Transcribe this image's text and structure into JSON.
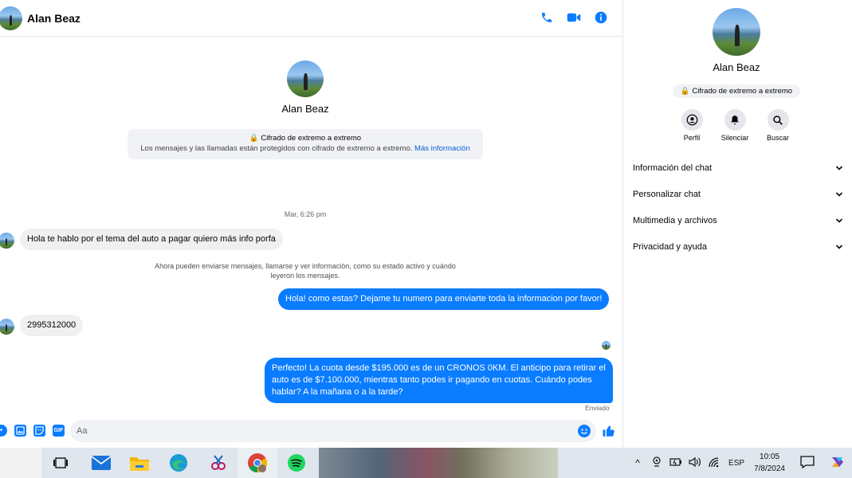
{
  "header": {
    "contact_name": "Alan Beaz",
    "icons": [
      "phone-icon",
      "video-camera-icon",
      "info-icon"
    ]
  },
  "intro": {
    "name": "Alan Beaz",
    "e2e_title": "🔒 Cifrado de extremo a extremo",
    "e2e_desc": "Los mensajes y las llamadas están protegidos con cifrado de extremo a extremo.",
    "e2e_link": "Más información"
  },
  "thread": {
    "timestamp": "Mar, 6:26 pm",
    "msg1": "Hola te hablo por el tema del auto a pagar quiero más info porfa",
    "system_note": "Ahora pueden enviarse mensajes, llamarse y ver información, como su estado activo y cuándo leyeron los mensajes.",
    "msg2": "Hola! como estas? Dejame tu numero para enviarte toda la informacion por favor!",
    "msg3": "2995312000",
    "msg4_line1": "Perfecto! La cuota desde $195.000 es de un CRONOS 0KM. El anticipo para retirar el",
    "msg4_line2": "auto es de $7.100.000, mientras tanto podes ir pagando en cuotas. Cuándo podes",
    "msg4_line3": "hablar? A la mañana o a la tarde?",
    "status": "Enviado"
  },
  "composer": {
    "placeholder": "Aa",
    "icons": [
      "plus-icon",
      "image-icon",
      "sticker-icon",
      "gif-icon",
      "emoji-icon",
      "thumbs-up-icon"
    ],
    "gif_label": "GIF"
  },
  "panel": {
    "name": "Alan Beaz",
    "badge": "🔒 Cifrado de extremo a extremo",
    "actions": [
      {
        "label": "Perfil",
        "icon": "profile-icon"
      },
      {
        "label": "Silenciar",
        "icon": "bell-icon"
      },
      {
        "label": "Buscar",
        "icon": "search-icon"
      }
    ],
    "sections": [
      "Información del chat",
      "Personalizar chat",
      "Multimedia y archivos",
      "Privacidad y ayuda"
    ]
  },
  "taskbar": {
    "apps": [
      "task-view-icon",
      "mail-icon",
      "file-explorer-icon",
      "edge-icon",
      "snipping-tool-icon",
      "chrome-icon",
      "spotify-icon"
    ],
    "language": "ESP",
    "time": "10:05",
    "date": "7/8/2024",
    "tray_chevron": "^"
  },
  "colors": {
    "accent": "#0a7cff",
    "incoming_bubble": "#f0f0f0",
    "link": "#0a5fd6"
  }
}
